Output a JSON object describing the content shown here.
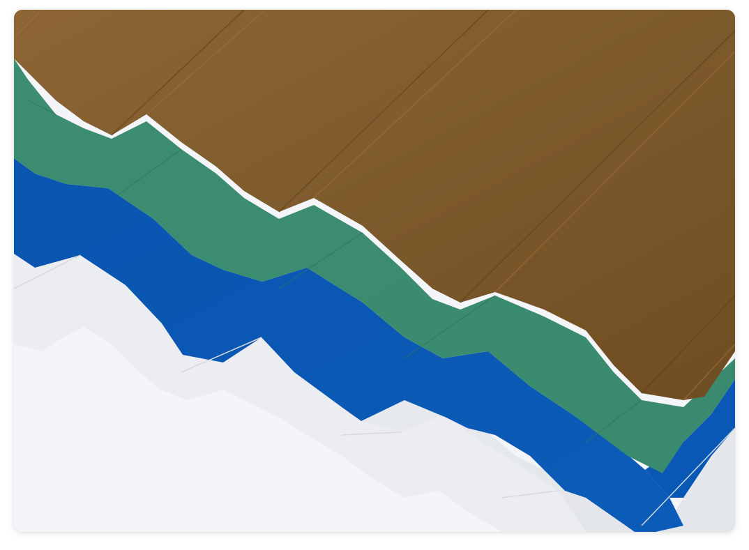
{
  "image": {
    "subject": "corrugated-roofing-sheets",
    "background_color": "#f3f5f9",
    "sheets": [
      {
        "name": "white-sheet",
        "color": "#e9ebef"
      },
      {
        "name": "blue-sheet",
        "color": "#0a58b3"
      },
      {
        "name": "green-sheet",
        "color": "#3f8d74"
      },
      {
        "name": "brown-sheet",
        "color": "#7f5a2d"
      }
    ]
  }
}
